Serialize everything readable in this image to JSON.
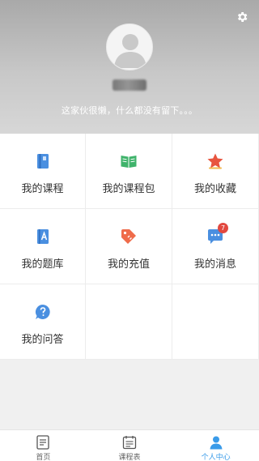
{
  "header": {
    "bio": "这家伙很懒，什么都没有留下。。。"
  },
  "menu": [
    {
      "label": "我的课程",
      "icon": "book-icon"
    },
    {
      "label": "我的课程包",
      "icon": "open-book-icon"
    },
    {
      "label": "我的收藏",
      "icon": "star-icon"
    },
    {
      "label": "我的题库",
      "icon": "question-bank-icon"
    },
    {
      "label": "我的充值",
      "icon": "recharge-tag-icon"
    },
    {
      "label": "我的消息",
      "icon": "message-icon",
      "badge": "7"
    },
    {
      "label": "我的问答",
      "icon": "question-bubble-icon"
    }
  ],
  "tabbar": {
    "items": [
      {
        "label": "首页",
        "icon": "home-list-icon",
        "active": false
      },
      {
        "label": "课程表",
        "icon": "schedule-icon",
        "active": false
      },
      {
        "label": "个人中心",
        "icon": "user-icon",
        "active": true
      }
    ]
  },
  "colors": {
    "accent": "#3a9be9",
    "badge": "#e2483f",
    "star": "#e8553f",
    "book_green": "#3fb36b",
    "icon_blue": "#4a8fe0"
  }
}
